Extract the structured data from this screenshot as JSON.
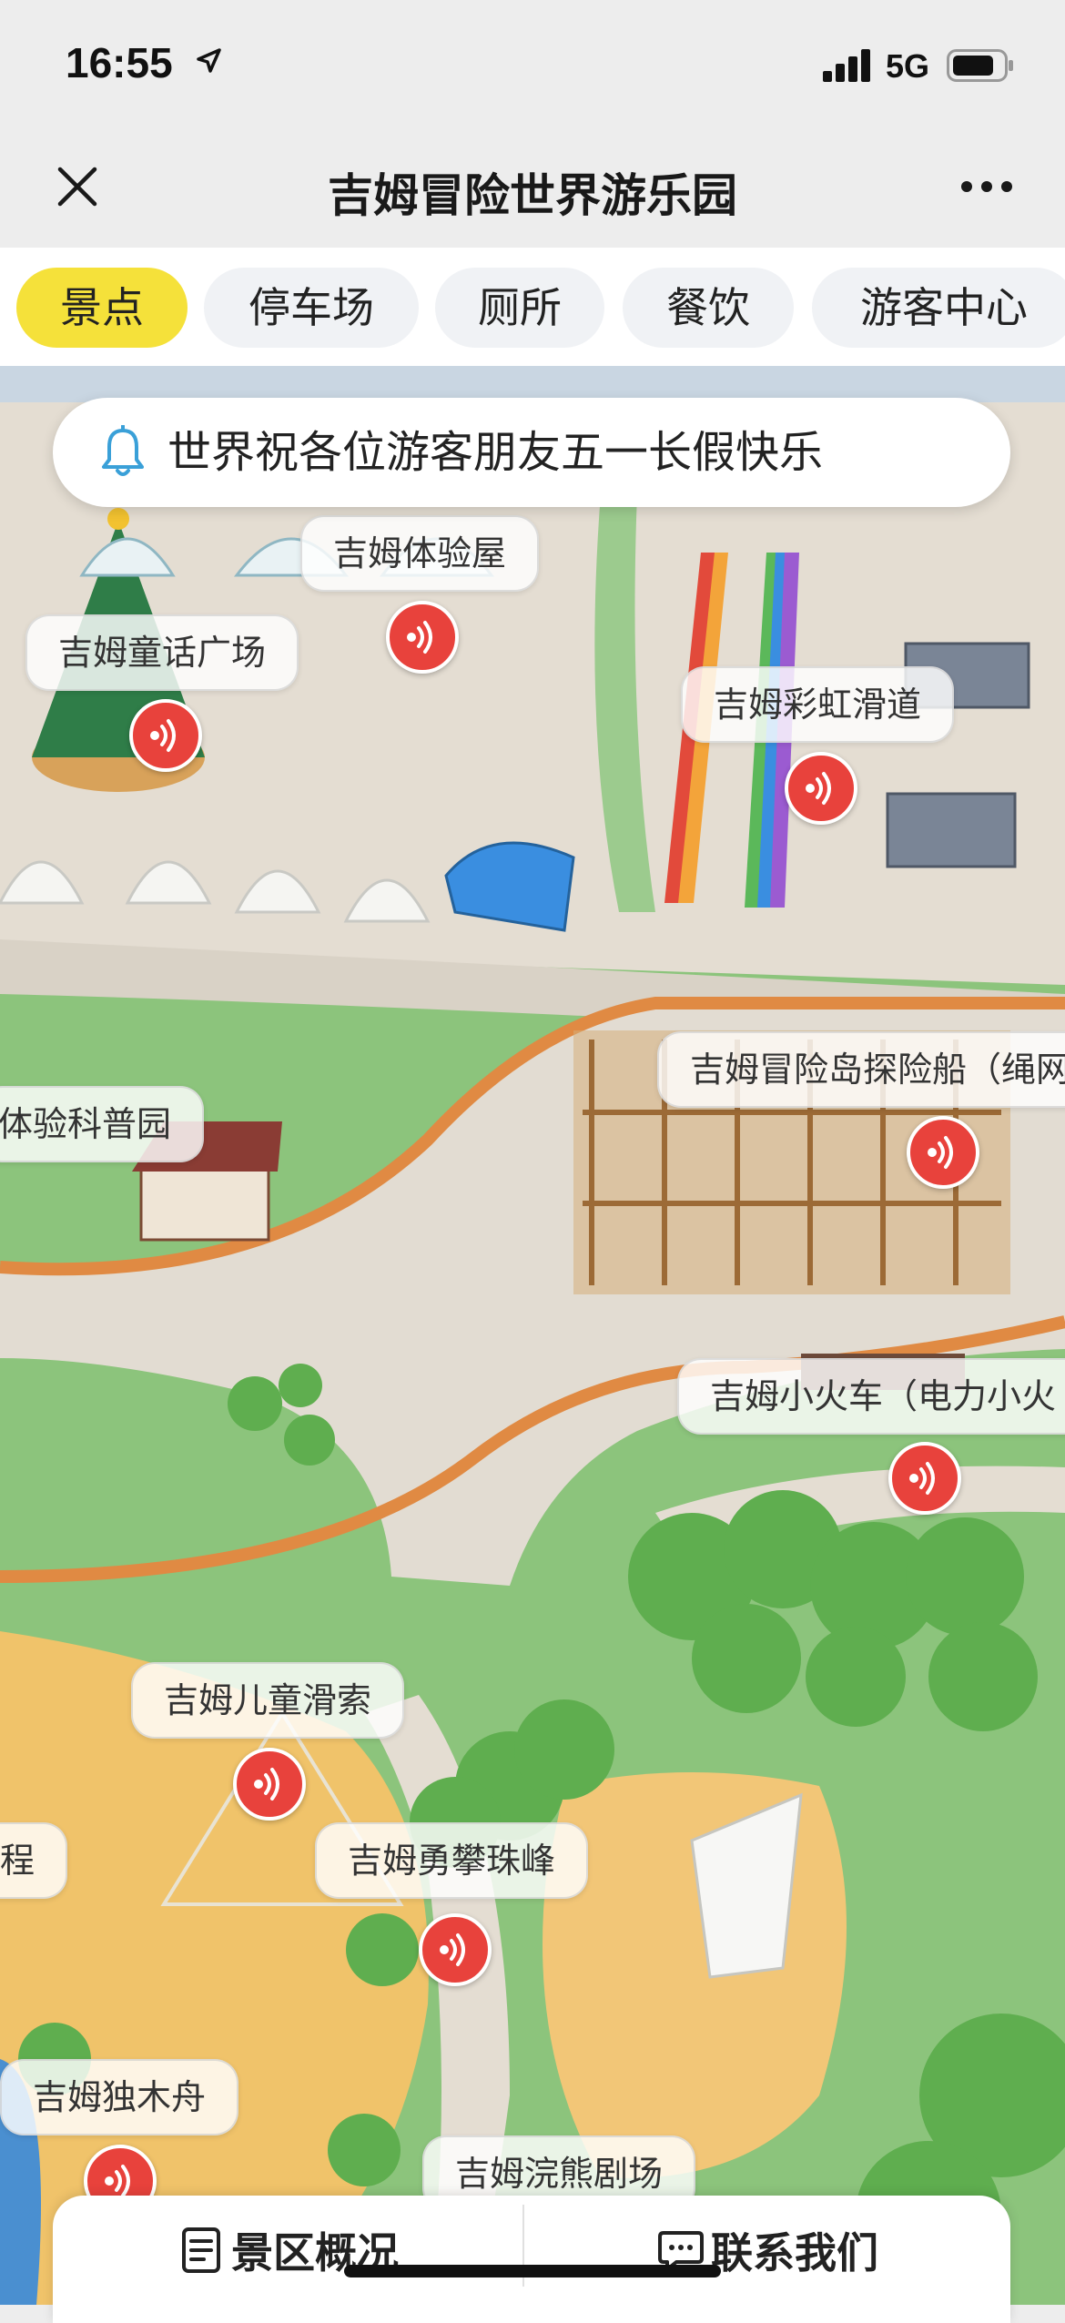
{
  "status_bar": {
    "time": "16:55",
    "network": "5G"
  },
  "nav": {
    "title": "吉姆冒险世界游乐园"
  },
  "tabs": [
    {
      "label": "景点",
      "active": true
    },
    {
      "label": "停车场",
      "active": false
    },
    {
      "label": "厕所",
      "active": false
    },
    {
      "label": "餐饮",
      "active": false
    },
    {
      "label": "游客中心",
      "active": false
    }
  ],
  "notice": {
    "text": "世界祝各位游客朋友五一长假快乐"
  },
  "attractions": [
    {
      "name": "吉姆体验屋"
    },
    {
      "name": "吉姆童话广场"
    },
    {
      "name": "吉姆彩虹滑道"
    },
    {
      "name": "吉姆冒险岛探险船（绳网"
    },
    {
      "name": "体验科普园"
    },
    {
      "name": "吉姆小火车（电力小火"
    },
    {
      "name": "吉姆儿童滑索"
    },
    {
      "name": "吉姆勇攀珠峰"
    },
    {
      "name": "程"
    },
    {
      "name": "吉姆独木舟"
    },
    {
      "name": "吉姆浣熊剧场"
    }
  ],
  "bottom_bar": {
    "overview_label": "景区概况",
    "contact_label": "联系我们"
  },
  "colors": {
    "accent_tab": "#f5e13a",
    "audio_marker": "#e8423c",
    "grass": "#86c27a",
    "path": "#e2dcd2",
    "sand": "#f0c36a"
  }
}
